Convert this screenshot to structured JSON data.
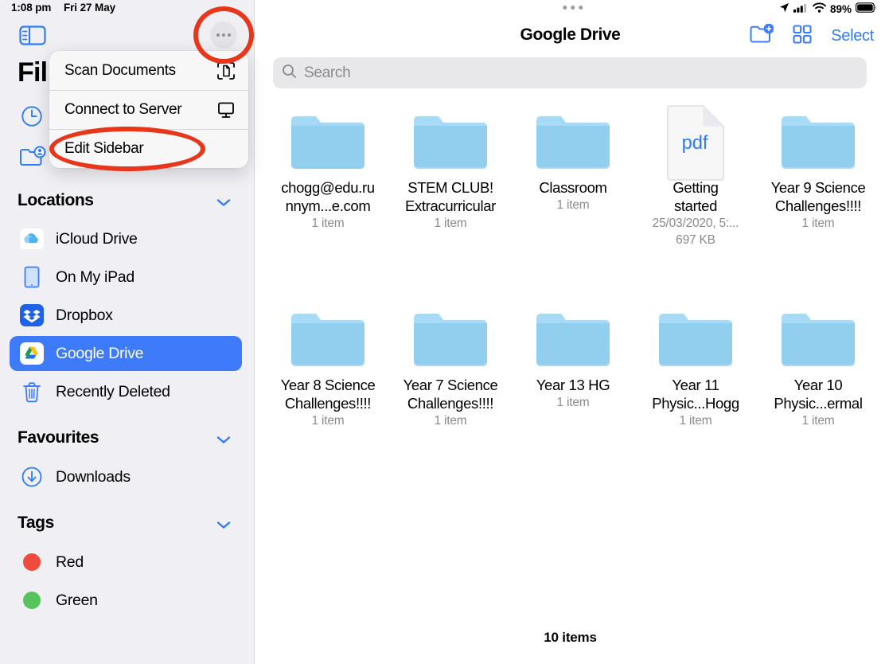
{
  "status_bar": {
    "time": "1:08 pm",
    "date": "Fri 27 May",
    "battery_percent": "89%",
    "icons": [
      "location-arrow-icon",
      "cellular-signal-icon",
      "wifi-icon",
      "battery-icon"
    ]
  },
  "sidebar": {
    "app_title": "Fil",
    "app_title_full": "Files",
    "toggle_icon": "sidebar-toggle-icon",
    "more_icon": "ellipsis-circle-icon",
    "quick_icons": [
      {
        "name": "recents-clock-icon"
      },
      {
        "name": "shared-folder-icon"
      }
    ],
    "sections": [
      {
        "id": "locations",
        "title": "Locations",
        "chevron": "chevron-down-icon",
        "items": [
          {
            "label": "iCloud Drive",
            "icon": "icloud-drive-icon",
            "selected": false
          },
          {
            "label": "On My iPad",
            "icon": "ipad-icon",
            "selected": false
          },
          {
            "label": "Dropbox",
            "icon": "dropbox-icon",
            "selected": false
          },
          {
            "label": "Google Drive",
            "icon": "google-drive-icon",
            "selected": true
          },
          {
            "label": "Recently Deleted",
            "icon": "trash-icon",
            "selected": false
          }
        ]
      },
      {
        "id": "favourites",
        "title": "Favourites",
        "chevron": "chevron-down-icon",
        "items": [
          {
            "label": "Downloads",
            "icon": "downloads-circle-icon",
            "selected": false
          }
        ]
      },
      {
        "id": "tags",
        "title": "Tags",
        "chevron": "chevron-down-icon",
        "items": [
          {
            "label": "Red",
            "icon": "tag-dot-icon",
            "color": "#f04a3c",
            "selected": false
          },
          {
            "label": "Green",
            "icon": "tag-dot-icon",
            "color": "#56c45c",
            "selected": false
          }
        ]
      }
    ]
  },
  "context_menu": {
    "items": [
      {
        "label": "Scan Documents",
        "icon": "scan-documents-icon"
      },
      {
        "label": "Connect to Server",
        "icon": "connect-to-server-icon"
      },
      {
        "label": "Edit Sidebar",
        "icon": ""
      }
    ]
  },
  "annotations": {
    "color": "#e8361b",
    "shapes": [
      {
        "name": "ellipsis-button-highlight",
        "target": "more-options-button"
      },
      {
        "name": "edit-sidebar-highlight",
        "target": "menu-item-edit-sidebar"
      }
    ]
  },
  "main": {
    "title": "Google Drive",
    "grabber_icon": "multitasking-handle-icon",
    "actions": [
      {
        "name": "new-folder-button",
        "icon": "new-folder-icon"
      },
      {
        "name": "view-grid-button",
        "icon": "grid-view-icon"
      },
      {
        "name": "select-button",
        "label": "Select"
      }
    ],
    "search": {
      "placeholder": "Search",
      "value": "",
      "icon": "search-icon"
    },
    "items": [
      {
        "name": "chogg@edu.ru\nnnym...e.com",
        "type": "folder",
        "meta1": "1 item",
        "meta2": ""
      },
      {
        "name": "STEM CLUB!\nExtracurricular",
        "type": "folder",
        "meta1": "1 item",
        "meta2": ""
      },
      {
        "name": "Classroom",
        "type": "folder",
        "meta1": "1 item",
        "meta2": ""
      },
      {
        "name": "Getting\nstarted",
        "type": "pdf",
        "badge": "pdf",
        "meta1": "25/03/2020, 5:...",
        "meta2": "697 KB"
      },
      {
        "name": "Year 9 Science\nChallenges!!!!",
        "type": "folder",
        "meta1": "1 item",
        "meta2": ""
      },
      {
        "name": "Year 8 Science\nChallenges!!!!",
        "type": "folder",
        "meta1": "1 item",
        "meta2": ""
      },
      {
        "name": "Year 7 Science\nChallenges!!!!",
        "type": "folder",
        "meta1": "1 item",
        "meta2": ""
      },
      {
        "name": "Year 13 HG",
        "type": "folder",
        "meta1": "1 item",
        "meta2": ""
      },
      {
        "name": "Year 11\nPhysic...Hogg",
        "type": "folder",
        "meta1": "1 item",
        "meta2": ""
      },
      {
        "name": "Year 10\nPhysic...ermal",
        "type": "folder",
        "meta1": "1 item",
        "meta2": ""
      }
    ],
    "footer_count": "10 items"
  },
  "colors": {
    "accent_blue": "#2f7cf6",
    "selected_blue": "#3d7bfb",
    "folder_blue": "#96d3f2",
    "sidebar_bg": "#f0eff4",
    "annotation_red": "#e8361b"
  }
}
